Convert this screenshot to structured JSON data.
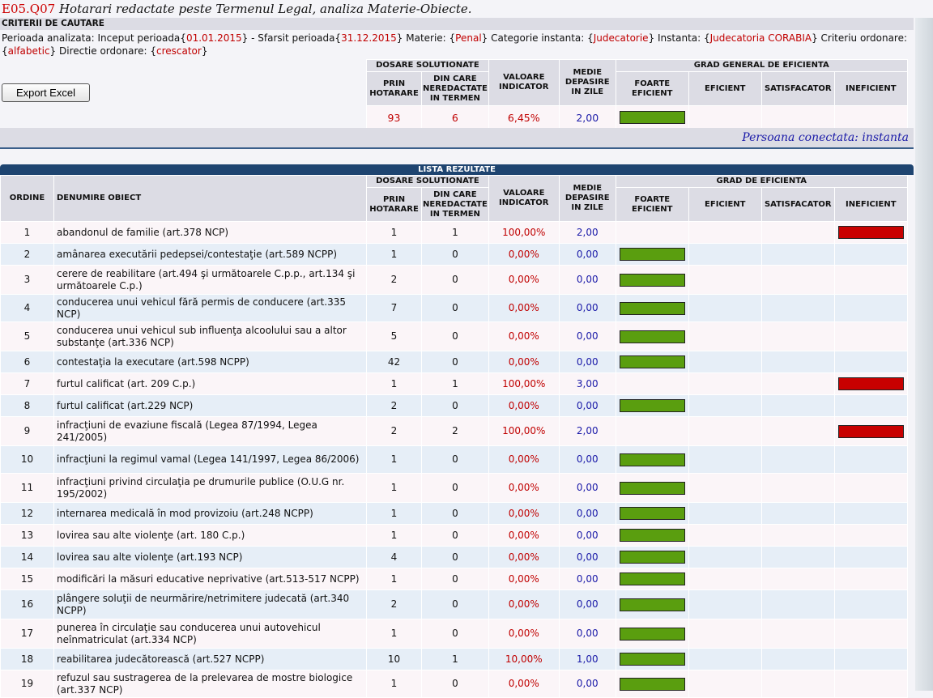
{
  "header": {
    "code": "E05.Q07",
    "title": " Hotarari redactate peste Termenul Legal, analiza Materie-Obiecte."
  },
  "criteria": {
    "heading": "CRITERII DE CAUTARE",
    "l_perioada": "Perioada analizata: Inceput perioada{",
    "start": "01.01.2015",
    "l_sfarsit": "} - Sfarsit perioada{",
    "end": "31.12.2015",
    "l_materie": "} Materie: {",
    "materie": "Penal",
    "l_categorie": "} Categorie instanta: {",
    "categorie": "Judecatorie",
    "l_instanta": "} Instanta: {",
    "instanta": "Judecatoria CORABIA",
    "l_criteriu": "} Criteriu ordonare: {",
    "criteriu": "alfabetic",
    "l_directie": "} Directie ordonare: {",
    "directie": "crescator",
    "close": "}"
  },
  "export_label": "Export Excel",
  "columns": {
    "dosare": "DOSARE SOLUTIONATE",
    "prin": "PRIN HOTARARE",
    "din": "DIN CARE NEREDACTATE IN TERMEN",
    "valoare": "VALOARE INDICATOR",
    "medie": "MEDIE DEPASIRE IN ZILE",
    "grad_general": "GRAD GENERAL DE EFICIENTA",
    "grad": "GRAD DE EFICIENTA",
    "foarte": "FOARTE EFICIENT",
    "eficient": "EFICIENT",
    "satisf": "SATISFACATOR",
    "inef": "INEFICIENT",
    "ordine": "ORDINE",
    "denumire": "DENUMIRE OBIECT"
  },
  "summary": {
    "prin": "93",
    "din": "6",
    "valoare": "6,45%",
    "medie": "2,00",
    "grade": "foarte"
  },
  "connected": "Persoana conectata: instanta",
  "list_title": "LISTA REZULTATE",
  "rows": [
    {
      "n": "1",
      "den": "abandonul de familie (art.378 NCP)",
      "prin": "1",
      "din": "1",
      "val": "100,00%",
      "med": "2,00",
      "grade": "inef"
    },
    {
      "n": "2",
      "den": "amânarea executării pedepsei/contestaţie (art.589 NCPP)",
      "prin": "1",
      "din": "0",
      "val": "0,00%",
      "med": "0,00",
      "grade": "foarte"
    },
    {
      "n": "3",
      "den": "cerere de reabilitare (art.494 şi următoarele C.p.p., art.134 şi următoarele C.p.)",
      "prin": "2",
      "din": "0",
      "val": "0,00%",
      "med": "0,00",
      "grade": "foarte"
    },
    {
      "n": "4",
      "den": "conducerea unui vehicul fără permis de conducere (art.335 NCP)",
      "prin": "7",
      "din": "0",
      "val": "0,00%",
      "med": "0,00",
      "grade": "foarte"
    },
    {
      "n": "5",
      "den": "conducerea unui vehicul sub influenţa alcoolului sau a altor substanţe (art.336 NCP)",
      "prin": "5",
      "din": "0",
      "val": "0,00%",
      "med": "0,00",
      "grade": "foarte"
    },
    {
      "n": "6",
      "den": "contestaţia la executare (art.598 NCPP)",
      "prin": "42",
      "din": "0",
      "val": "0,00%",
      "med": "0,00",
      "grade": "foarte"
    },
    {
      "n": "7",
      "den": "furtul calificat (art. 209 C.p.)",
      "prin": "1",
      "din": "1",
      "val": "100,00%",
      "med": "3,00",
      "grade": "inef"
    },
    {
      "n": "8",
      "den": "furtul calificat (art.229 NCP)",
      "prin": "2",
      "din": "0",
      "val": "0,00%",
      "med": "0,00",
      "grade": "foarte"
    },
    {
      "n": "9",
      "den": "infracţiuni de evaziune fiscală (Legea 87/1994, Legea 241/2005)",
      "prin": "2",
      "din": "2",
      "val": "100,00%",
      "med": "2,00",
      "grade": "inef"
    },
    {
      "n": "10",
      "den": "infracţiuni la regimul vamal (Legea 141/1997, Legea 86/2006)",
      "prin": "1",
      "din": "0",
      "val": "0,00%",
      "med": "0,00",
      "grade": "foarte"
    },
    {
      "n": "11",
      "den": "infracţiuni privind circulaţia pe drumurile publice (O.U.G nr. 195/2002)",
      "prin": "1",
      "din": "0",
      "val": "0,00%",
      "med": "0,00",
      "grade": "foarte"
    },
    {
      "n": "12",
      "den": "internarea medicală în mod provizoiu (art.248 NCPP)",
      "prin": "1",
      "din": "0",
      "val": "0,00%",
      "med": "0,00",
      "grade": "foarte"
    },
    {
      "n": "13",
      "den": "lovirea sau alte violenţe (art. 180 C.p.)",
      "prin": "1",
      "din": "0",
      "val": "0,00%",
      "med": "0,00",
      "grade": "foarte"
    },
    {
      "n": "14",
      "den": "lovirea sau alte violenţe (art.193 NCP)",
      "prin": "4",
      "din": "0",
      "val": "0,00%",
      "med": "0,00",
      "grade": "foarte"
    },
    {
      "n": "15",
      "den": "modificări la măsuri educative neprivative (art.513-517 NCPP)",
      "prin": "1",
      "din": "0",
      "val": "0,00%",
      "med": "0,00",
      "grade": "foarte"
    },
    {
      "n": "16",
      "den": "plângere soluţii de neurmărire/netrimitere judecată (art.340 NCPP)",
      "prin": "2",
      "din": "0",
      "val": "0,00%",
      "med": "0,00",
      "grade": "foarte"
    },
    {
      "n": "17",
      "den": "punerea în circulaţie sau conducerea unui autovehicul neînmatriculat (art.334 NCP)",
      "prin": "1",
      "din": "0",
      "val": "0,00%",
      "med": "0,00",
      "grade": "foarte"
    },
    {
      "n": "18",
      "den": "reabilitarea judecătorească (art.527 NCPP)",
      "prin": "10",
      "din": "1",
      "val": "10,00%",
      "med": "1,00",
      "grade": "foarte"
    },
    {
      "n": "19",
      "den": "refuzul sau sustragerea de la prelevarea de mostre biologice (art.337 NCP)",
      "prin": "1",
      "din": "0",
      "val": "0,00%",
      "med": "0,00",
      "grade": "foarte"
    }
  ]
}
